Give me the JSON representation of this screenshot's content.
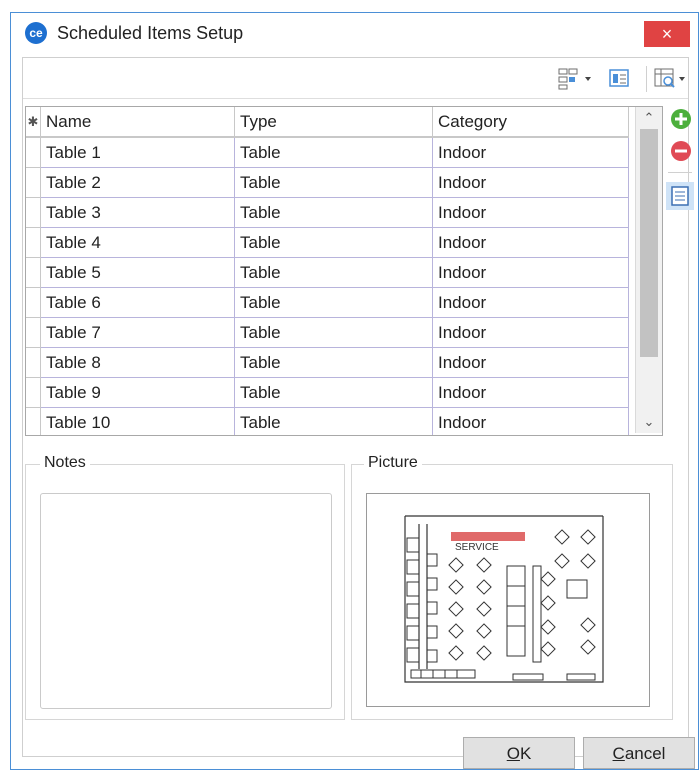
{
  "window": {
    "title": "Scheduled Items Setup",
    "app_icon": "ce",
    "close_label": "×"
  },
  "grid": {
    "indicator": "✱",
    "columns": [
      "Name",
      "Type",
      "Category"
    ],
    "rows": [
      [
        "Table 1",
        "Table",
        "Indoor"
      ],
      [
        "Table 2",
        "Table",
        "Indoor"
      ],
      [
        "Table 3",
        "Table",
        "Indoor"
      ],
      [
        "Table 4",
        "Table",
        "Indoor"
      ],
      [
        "Table 5",
        "Table",
        "Indoor"
      ],
      [
        "Table 6",
        "Table",
        "Indoor"
      ],
      [
        "Table 7",
        "Table",
        "Indoor"
      ],
      [
        "Table 8",
        "Table",
        "Indoor"
      ],
      [
        "Table 9",
        "Table",
        "Indoor"
      ],
      [
        "Table 10",
        "Table",
        "Indoor"
      ]
    ]
  },
  "notes": {
    "label": "Notes",
    "value": ""
  },
  "picture": {
    "label": "Picture"
  },
  "buttons": {
    "ok_prefix": "",
    "ok_mnemonic": "O",
    "ok_rest": "K",
    "cancel_mnemonic": "C",
    "cancel_rest": "ancel"
  },
  "colors": {
    "accent": "#1d6fd0",
    "close": "#e04343",
    "add": "#4caf3c",
    "remove": "#e04a55",
    "grid_line": "#b8b4dc"
  },
  "icons": [
    "layout-options-icon",
    "form-view-icon",
    "column-chooser-icon",
    "add-icon",
    "remove-icon",
    "detail-view-icon",
    "floorplan-picture"
  ]
}
